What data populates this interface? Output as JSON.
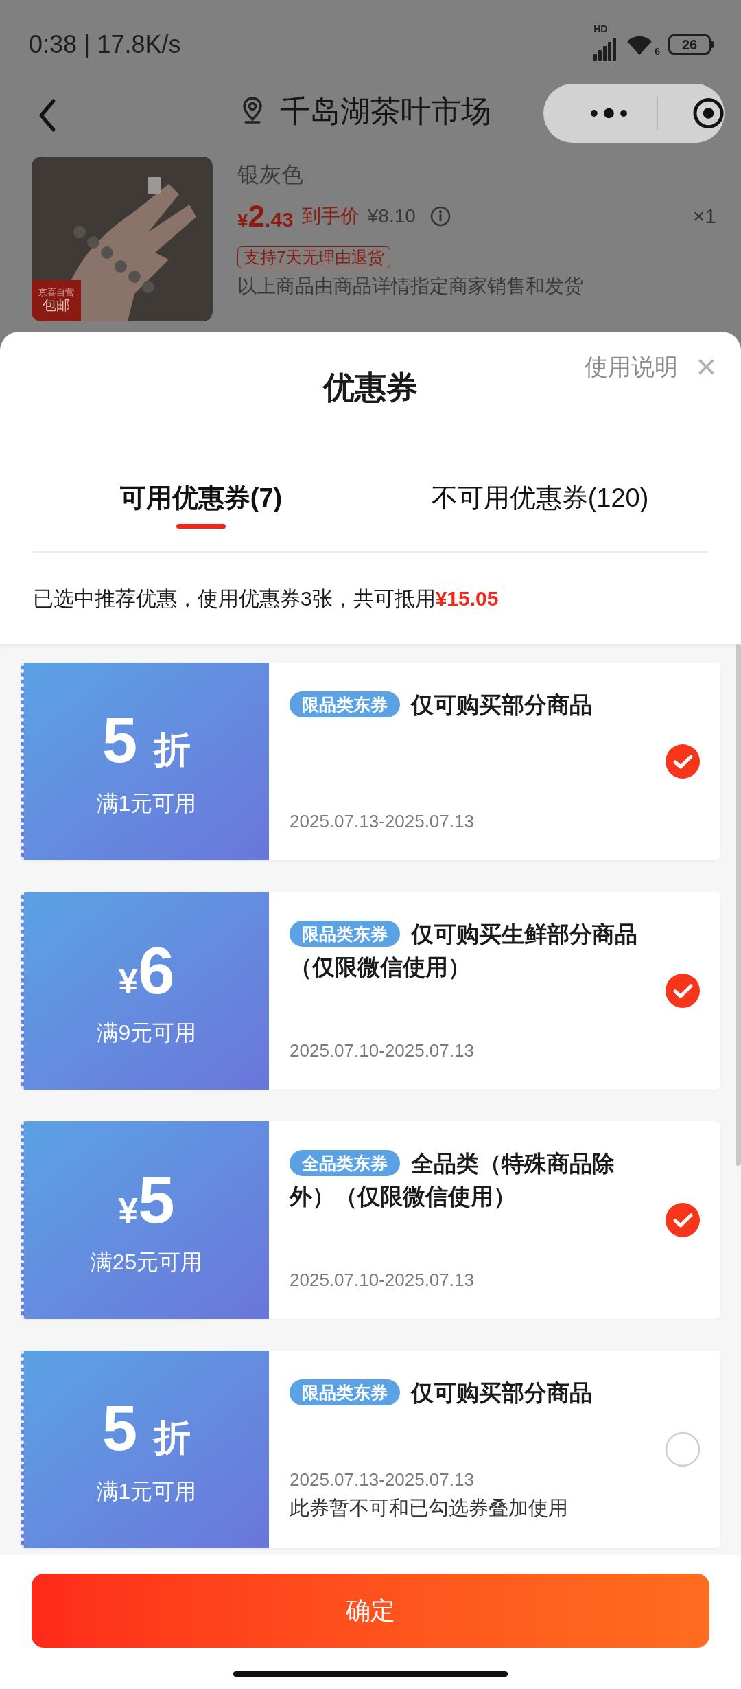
{
  "status_bar": {
    "time": "0:38 | 17.8K/s",
    "network_label": "HD",
    "wifi_label": "6",
    "battery": "26"
  },
  "nav": {
    "title": "千岛湖茶叶市场"
  },
  "product": {
    "kind": "picture",
    "badge_top": "京喜自营",
    "badge_bottom": "包邮",
    "variant": "银灰色",
    "price_currency": "¥",
    "price_integer": "2",
    "price_decimal": ".43",
    "price_label": "到手价",
    "original_price": "¥8.10",
    "quantity": "×1",
    "return_tag": "支持7天无理由退货",
    "seller_note": "以上商品由商品详情指定商家销售和发货"
  },
  "sheet": {
    "title": "优惠券",
    "help_link": "使用说明",
    "close": "×"
  },
  "tabs": [
    {
      "label": "可用优惠券(7)",
      "selected": true
    },
    {
      "label": "不可用优惠券(120)",
      "selected": false
    }
  ],
  "summary": {
    "text": "已选中推荐优惠，使用优惠券3张，共可抵用",
    "amount": "¥15.05"
  },
  "coupons": [
    {
      "kind": "discount",
      "amount": "5",
      "unit": "折",
      "condition": "满1元可用",
      "tag": "限品类东券",
      "title": "仅可购买部分商品",
      "date": "2025.07.13-2025.07.13",
      "checked": true
    },
    {
      "kind": "cash",
      "currency": "¥",
      "amount": "6",
      "condition": "满9元可用",
      "tag": "限品类东券",
      "title": "仅可购买生鲜部分商品（仅限微信使用）",
      "date": "2025.07.10-2025.07.13",
      "checked": true
    },
    {
      "kind": "cash",
      "currency": "¥",
      "amount": "5",
      "condition": "满25元可用",
      "tag": "全品类东券",
      "title": "全品类（特殊商品除外）（仅限微信使用）",
      "date": "2025.07.10-2025.07.13",
      "checked": true
    },
    {
      "kind": "discount",
      "amount": "5",
      "unit": "折",
      "condition": "满1元可用",
      "tag": "限品类东券",
      "title": "仅可购买部分商品",
      "date": "2025.07.13-2025.07.13",
      "note": "此券暂不可和已勾选券叠加使用",
      "checked": false
    }
  ],
  "confirm_button": "确定"
}
